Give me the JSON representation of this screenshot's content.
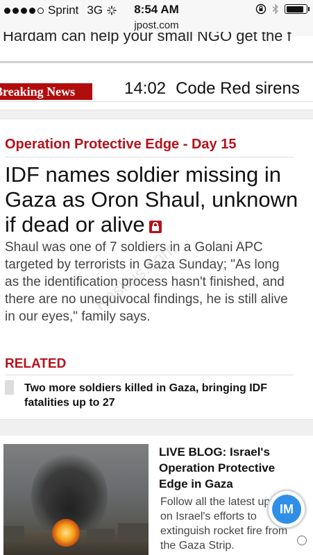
{
  "status_bar": {
    "carrier": "Sprint",
    "network": "3G",
    "time": "8:54 AM",
    "battery_level": 0.8
  },
  "url_bar": {
    "domain": "jpost.com"
  },
  "promo": {
    "text": "Hardam can help your small NGO get the f"
  },
  "breaking": {
    "label": "Breaking News",
    "time": "14:02",
    "text": "Code Red sirens"
  },
  "article": {
    "section": "Operation Protective Edge - Day 15",
    "headline": "IDF names soldier missing in Gaza as Oron Shaul, unknown if dead or alive",
    "summary": "Shaul was one of 7 soldiers in a Golani APC targeted by terrorists in Gaza Sunday; \"As long as the identification process hasn't finished, and there are no unequivocal findings, he is still alive in our eyes,\" family says.",
    "watermark": "Kaskus.com"
  },
  "related": {
    "title": "RELATED",
    "items": [
      {
        "text": "Two more soldiers killed in Gaza, bringing IDF fatalities up to 27"
      }
    ]
  },
  "live_blog": {
    "title": "LIVE BLOG: Israel's Operation Protective Edge in Gaza",
    "description": "Follow all the latest updates on Israel's efforts to extinguish rocket fire from the Gaza Strip."
  },
  "chat_widget": {
    "label": "IM"
  },
  "colors": {
    "accent_red": "#b5121b",
    "breaking_bg": "#b20d0d",
    "chat_blue": "#2f8ee6"
  },
  "icons": [
    "signal-dots-icon",
    "activity-spinner-icon",
    "lock-rotation-icon",
    "bluetooth-icon",
    "battery-icon",
    "premium-lock-icon",
    "chat-icon"
  ]
}
